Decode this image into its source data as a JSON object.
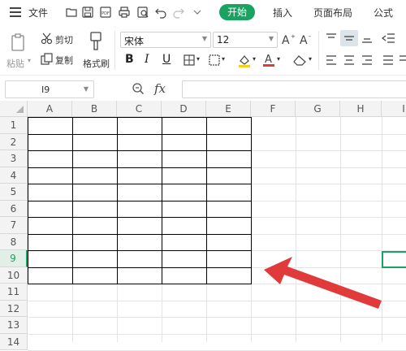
{
  "menubar": {
    "file_label": "文件",
    "tabs": [
      {
        "label": "开始",
        "active": true
      },
      {
        "label": "插入"
      },
      {
        "label": "页面布局"
      },
      {
        "label": "公式"
      }
    ],
    "quick_access_icons": [
      "open-folder-icon",
      "save-icon",
      "pdf-icon",
      "print-icon",
      "print-preview-icon",
      "undo-icon",
      "redo-icon",
      "chevron-down-icon"
    ]
  },
  "ribbon": {
    "paste_label": "粘贴",
    "cut_label": "剪切",
    "copy_label": "复制",
    "format_painter_label": "格式刷",
    "font_name": "宋体",
    "font_size": "12",
    "bold": "B",
    "italic": "I",
    "underline": "U"
  },
  "formula_bar": {
    "cell_ref": "I9",
    "fx_label": "fx",
    "formula_value": ""
  },
  "sheet": {
    "columns": [
      "A",
      "B",
      "C",
      "D",
      "E",
      "F",
      "G",
      "H",
      "I"
    ],
    "rows": [
      "1",
      "2",
      "3",
      "4",
      "5",
      "6",
      "7",
      "8",
      "9",
      "10",
      "11",
      "12",
      "13",
      "14"
    ],
    "selected_row": "9",
    "selected_cell": "I9",
    "bordered_range": "A1:E10",
    "annotation_arrow_color": "#e03a3a"
  },
  "colors": {
    "accent": "#1aa260",
    "arrow": "#e03a3a"
  }
}
